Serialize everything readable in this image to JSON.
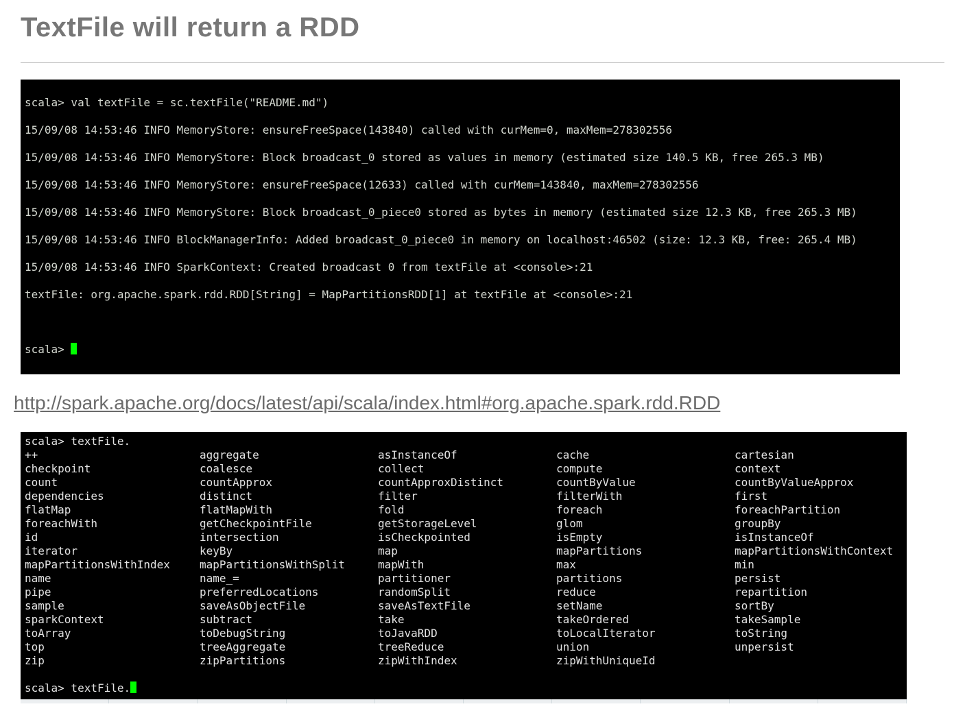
{
  "title": "TextFile will return a RDD",
  "terminal1": {
    "line0": "scala> val textFile = sc.textFile(\"README.md\")",
    "line1": "15/09/08 14:53:46 INFO MemoryStore: ensureFreeSpace(143840) called with curMem=0, maxMem=278302556",
    "line2": "15/09/08 14:53:46 INFO MemoryStore: Block broadcast_0 stored as values in memory (estimated size 140.5 KB, free 265.3 MB)",
    "line3": "15/09/08 14:53:46 INFO MemoryStore: ensureFreeSpace(12633) called with curMem=143840, maxMem=278302556",
    "line4": "15/09/08 14:53:46 INFO MemoryStore: Block broadcast_0_piece0 stored as bytes in memory (estimated size 12.3 KB, free 265.3 MB)",
    "line5": "15/09/08 14:53:46 INFO BlockManagerInfo: Added broadcast_0_piece0 in memory on localhost:46502 (size: 12.3 KB, free: 265.4 MB)",
    "line6": "15/09/08 14:53:46 INFO SparkContext: Created broadcast 0 from textFile at <console>:21",
    "line7": "textFile: org.apache.spark.rdd.RDD[String] = MapPartitionsRDD[1] at textFile at <console>:21",
    "prompt": "scala> "
  },
  "doc_link": "http://spark.apache.org/docs/latest/api/scala/index.html#org.apache.spark.rdd.RDD",
  "terminal2": {
    "header": "scala> textFile.",
    "rows": [
      [
        "++",
        "aggregate",
        "asInstanceOf",
        "cache",
        "cartesian"
      ],
      [
        "checkpoint",
        "coalesce",
        "collect",
        "compute",
        "context"
      ],
      [
        "count",
        "countApprox",
        "countApproxDistinct",
        "countByValue",
        "countByValueApprox"
      ],
      [
        "dependencies",
        "distinct",
        "filter",
        "filterWith",
        "first"
      ],
      [
        "flatMap",
        "flatMapWith",
        "fold",
        "foreach",
        "foreachPartition"
      ],
      [
        "foreachWith",
        "getCheckpointFile",
        "getStorageLevel",
        "glom",
        "groupBy"
      ],
      [
        "id",
        "intersection",
        "isCheckpointed",
        "isEmpty",
        "isInstanceOf"
      ],
      [
        "iterator",
        "keyBy",
        "map",
        "mapPartitions",
        "mapPartitionsWithContext"
      ],
      [
        "mapPartitionsWithIndex",
        "mapPartitionsWithSplit",
        "mapWith",
        "max",
        "min"
      ],
      [
        "name",
        "name_=",
        "partitioner",
        "partitions",
        "persist"
      ],
      [
        "pipe",
        "preferredLocations",
        "randomSplit",
        "reduce",
        "repartition"
      ],
      [
        "sample",
        "saveAsObjectFile",
        "saveAsTextFile",
        "setName",
        "sortBy"
      ],
      [
        "sparkContext",
        "subtract",
        "take",
        "takeOrdered",
        "takeSample"
      ],
      [
        "toArray",
        "toDebugString",
        "toJavaRDD",
        "toLocalIterator",
        "toString"
      ],
      [
        "top",
        "treeAggregate",
        "treeReduce",
        "union",
        "unpersist"
      ],
      [
        "zip",
        "zipPartitions",
        "zipWithIndex",
        "zipWithUniqueId",
        ""
      ]
    ],
    "prompt": "scala> textFile."
  }
}
